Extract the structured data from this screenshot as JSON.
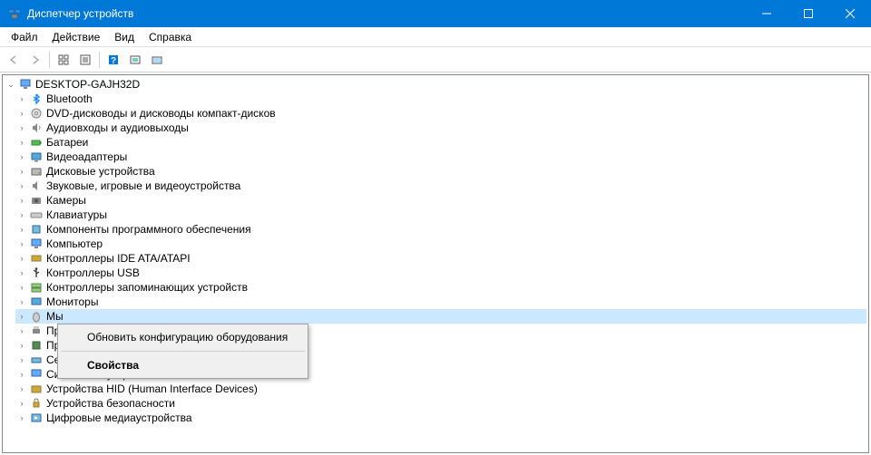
{
  "titlebar": {
    "title": "Диспетчер устройств"
  },
  "menubar": {
    "file": "Файл",
    "action": "Действие",
    "view": "Вид",
    "help": "Справка"
  },
  "tree": {
    "root": "DESKTOP-GAJH32D",
    "items": [
      "Bluetooth",
      "DVD-дисководы и дисководы компакт-дисков",
      "Аудиовходы и аудиовыходы",
      "Батареи",
      "Видеоадаптеры",
      "Дисковые устройства",
      "Звуковые, игровые и видеоустройства",
      "Камеры",
      "Клавиатуры",
      "Компоненты программного обеспечения",
      "Компьютер",
      "Контроллеры IDE ATA/ATAPI",
      "Контроллеры USB",
      "Контроллеры запоминающих устройств",
      "Мониторы",
      "Мы",
      "Пр",
      "Пр",
      "Сетевые адаптеры",
      "Системные устройства",
      "Устройства HID (Human Interface Devices)",
      "Устройства безопасности",
      "Цифровые медиаустройства"
    ]
  },
  "context_menu": {
    "refresh": "Обновить конфигурацию оборудования",
    "properties": "Свойства"
  }
}
